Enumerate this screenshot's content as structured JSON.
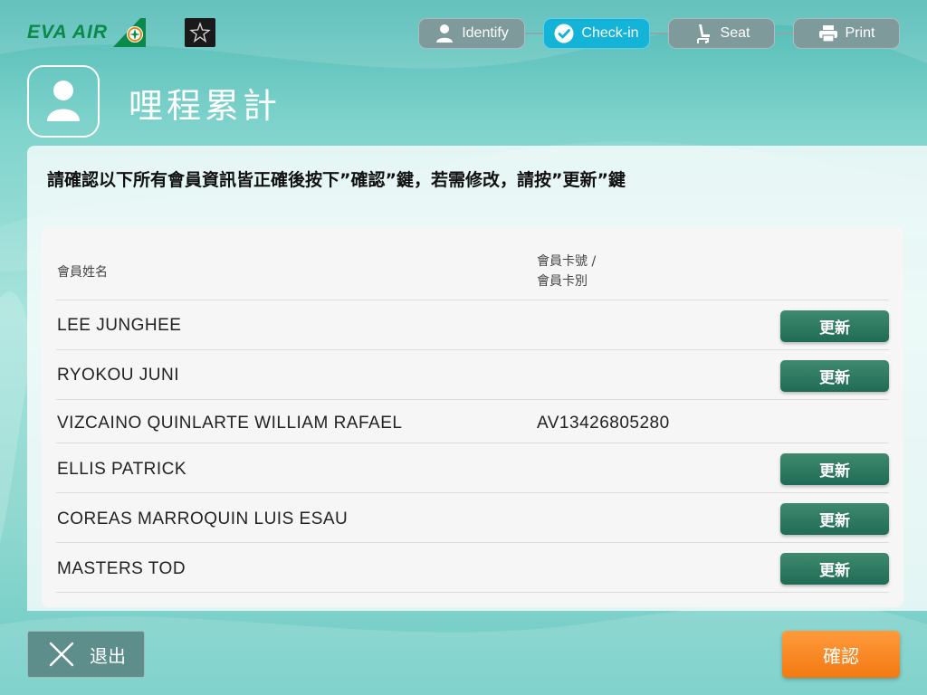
{
  "brand": {
    "name": "EVA AIR",
    "partner_badge": "STAR ALLIANCE"
  },
  "steps": [
    {
      "label": "Identify",
      "icon": "person-icon",
      "active": false
    },
    {
      "label": "Check-in",
      "icon": "checkmark-icon",
      "active": true
    },
    {
      "label": "Seat",
      "icon": "seat-icon",
      "active": false
    },
    {
      "label": "Print",
      "icon": "printer-icon",
      "active": false
    }
  ],
  "page": {
    "title": "哩程累計",
    "instruction": "請確認以下所有會員資訊皆正確後按下”確認”鍵，若需修改，請按”更新”鍵"
  },
  "table": {
    "header_name": "會員姓名",
    "header_card_line1": "會員卡號 /",
    "header_card_line2": "會員卡別",
    "rows": [
      {
        "name": "LEE JUNGHEE",
        "card": "",
        "update_label": "更新"
      },
      {
        "name": "RYOKOU JUNI",
        "card": "",
        "update_label": "更新"
      },
      {
        "name": "VIZCAINO QUINLARTE WILLIAM RAFAEL",
        "card": "AV13426805280",
        "update_label": ""
      },
      {
        "name": "ELLIS PATRICK",
        "card": "",
        "update_label": "更新"
      },
      {
        "name": "COREAS MARROQUIN LUIS ESAU",
        "card": "",
        "update_label": "更新"
      },
      {
        "name": "MASTERS TOD",
        "card": "",
        "update_label": "更新"
      }
    ]
  },
  "footer": {
    "exit_label": "退出",
    "confirm_label": "確認"
  },
  "colors": {
    "accent": "#13b4d8",
    "update_button": "#2f7a61",
    "confirm_button": "#f58a22",
    "brand_green": "#0a8a4a"
  }
}
